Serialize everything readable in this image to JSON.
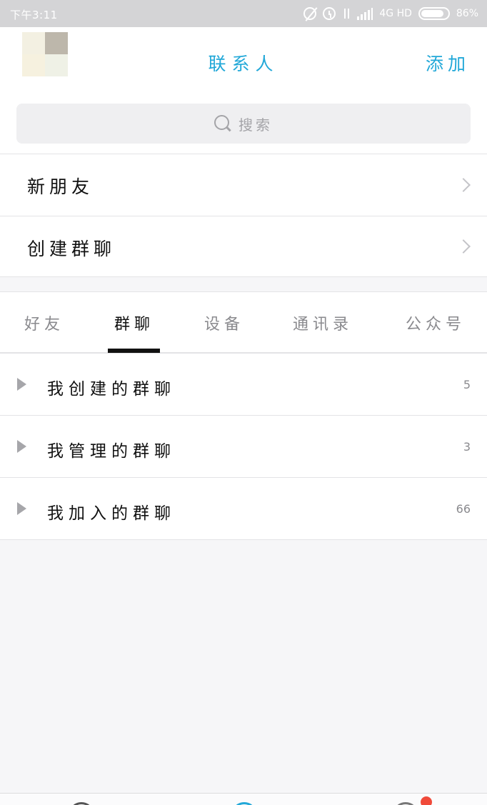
{
  "status_bar": {
    "time": "下午3:11",
    "network": "4G HD",
    "battery_percent": "86%",
    "battery_level": 0.86,
    "icons": [
      "alarm-off-icon",
      "alarm-clock-icon",
      "data-arrows-icon",
      "signal-icon",
      "battery-icon"
    ]
  },
  "header": {
    "title": "联系人",
    "add_label": "添加"
  },
  "search": {
    "placeholder": "搜索"
  },
  "shortcuts": [
    {
      "label": "新朋友"
    },
    {
      "label": "创建群聊"
    }
  ],
  "tabs": [
    {
      "label": "好友",
      "active": false
    },
    {
      "label": "群聊",
      "active": true
    },
    {
      "label": "设备",
      "active": false
    },
    {
      "label": "通讯录",
      "active": false
    },
    {
      "label": "公众号",
      "active": false
    }
  ],
  "groups": [
    {
      "label": "我创建的群聊",
      "count": "5"
    },
    {
      "label": "我管理的群聊",
      "count": "3"
    },
    {
      "label": "我加入的群聊",
      "count": "66"
    }
  ],
  "colors": {
    "accent": "#22a8d8",
    "status_bar": "#d4d4d6",
    "badge": "#f04a3a"
  }
}
